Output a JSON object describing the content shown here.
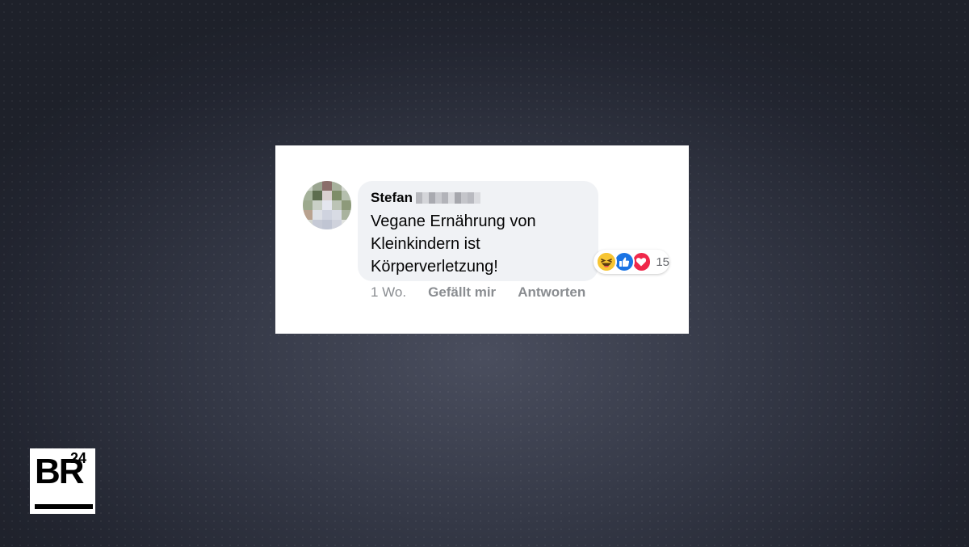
{
  "comment": {
    "author_first_name": "Stefan",
    "text": "Vegane Ernährung von Kleinkindern ist Körperverletzung!",
    "reactions": {
      "types": [
        "haha-icon",
        "like-icon",
        "love-icon"
      ],
      "count": "15"
    },
    "actions": {
      "timestamp": "1 Wo.",
      "like_label": "Gefällt mir",
      "reply_label": "Antworten"
    }
  },
  "branding": {
    "logo_main": "BR",
    "logo_superscript": "24"
  },
  "colors": {
    "like_blue": "#1b74e4",
    "love_red": "#f0284a",
    "haha_yellow": "#f7c533",
    "bubble_gray": "#f0f2f5",
    "meta_gray": "#8a8d91"
  }
}
